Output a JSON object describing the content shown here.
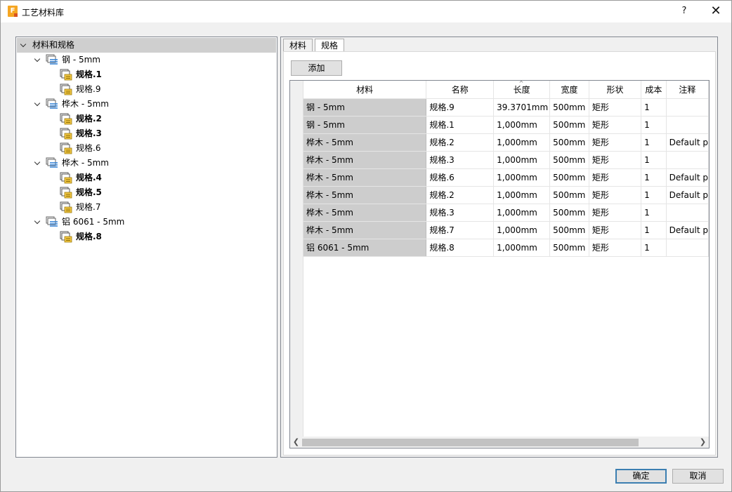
{
  "window": {
    "title": "工艺材料库",
    "app_icon_letter": "F",
    "help_label": "?",
    "close_label": "✕"
  },
  "tree": {
    "root_label": "材料和规格",
    "groups": [
      {
        "label": "钢 - 5mm",
        "icon": "material-stack-icon",
        "children": [
          {
            "label": "规格.1",
            "bold": true
          },
          {
            "label": "规格.9",
            "bold": false
          }
        ]
      },
      {
        "label": "桦木 - 5mm",
        "icon": "material-stack-icon",
        "children": [
          {
            "label": "规格.2",
            "bold": true
          },
          {
            "label": "规格.3",
            "bold": true
          },
          {
            "label": "规格.6",
            "bold": false
          }
        ]
      },
      {
        "label": "桦木 - 5mm",
        "icon": "material-stack-icon",
        "children": [
          {
            "label": "规格.4",
            "bold": true
          },
          {
            "label": "规格.5",
            "bold": true
          },
          {
            "label": "规格.7",
            "bold": false
          }
        ]
      },
      {
        "label": "铝 6061 - 5mm",
        "icon": "material-stack-icon",
        "children": [
          {
            "label": "规格.8",
            "bold": true
          }
        ]
      }
    ]
  },
  "tabs": [
    {
      "label": "材料",
      "active": false
    },
    {
      "label": "规格",
      "active": true
    }
  ],
  "add_button_label": "添加",
  "grid": {
    "columns": [
      "材料",
      "名称",
      "长度",
      "宽度",
      "形状",
      "成本",
      "注释"
    ],
    "sorted_column": "长度",
    "rows": [
      [
        "钢 - 5mm",
        "规格.9",
        "39.3701mm",
        "500mm",
        "矩形",
        "1",
        ""
      ],
      [
        "钢 - 5mm",
        "规格.1",
        "1,000mm",
        "500mm",
        "矩形",
        "1",
        ""
      ],
      [
        "桦木 - 5mm",
        "规格.2",
        "1,000mm",
        "500mm",
        "矩形",
        "1",
        "Default p"
      ],
      [
        "桦木 - 5mm",
        "规格.3",
        "1,000mm",
        "500mm",
        "矩形",
        "1",
        ""
      ],
      [
        "桦木 - 5mm",
        "规格.6",
        "1,000mm",
        "500mm",
        "矩形",
        "1",
        "Default p"
      ],
      [
        "桦木 - 5mm",
        "规格.2",
        "1,000mm",
        "500mm",
        "矩形",
        "1",
        "Default p"
      ],
      [
        "桦木 - 5mm",
        "规格.3",
        "1,000mm",
        "500mm",
        "矩形",
        "1",
        ""
      ],
      [
        "桦木 - 5mm",
        "规格.7",
        "1,000mm",
        "500mm",
        "矩形",
        "1",
        "Default p"
      ],
      [
        "铝 6061 - 5mm",
        "规格.8",
        "1,000mm",
        "500mm",
        "矩形",
        "1",
        ""
      ]
    ]
  },
  "footer": {
    "ok_label": "确定",
    "cancel_label": "取消"
  },
  "colors": {
    "material_cell_bg": "#cdcdcd",
    "ok_border": "#3c7fb1",
    "app_icon": "#f5a623"
  }
}
